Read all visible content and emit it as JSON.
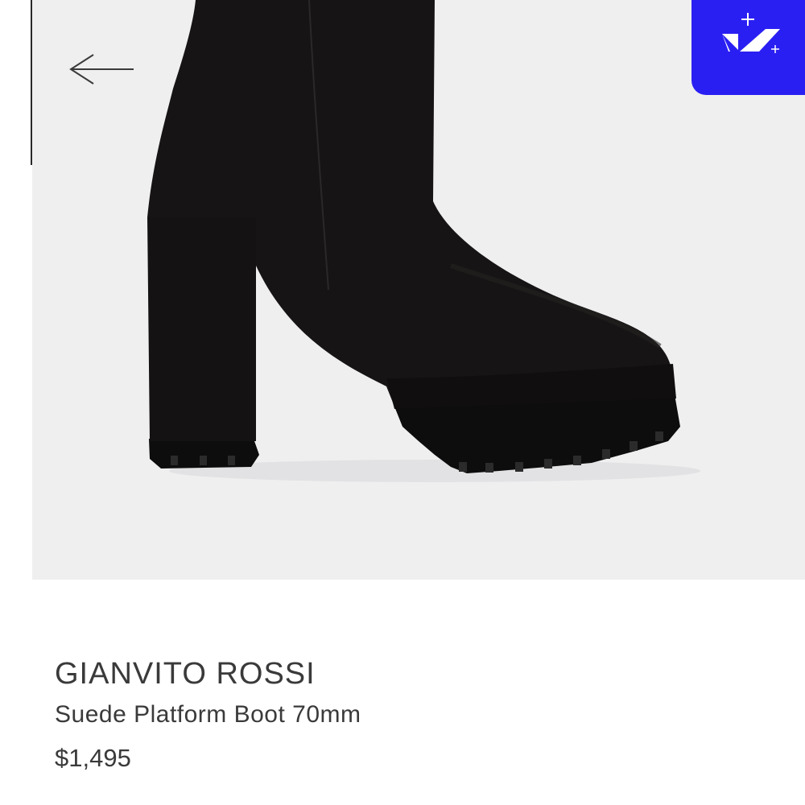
{
  "product": {
    "brand": "GIANVITO ROSSI",
    "name": "Suede Platform Boot 70mm",
    "price": "$1,495",
    "image_description": "black suede platform ankle boot with block heel and lug sole"
  },
  "nav": {
    "back_icon": "arrow-left-icon"
  },
  "badge": {
    "icon": "checkmark-sparkle-icon",
    "color": "#2a1ff2"
  },
  "colors": {
    "image_background": "#efeff0",
    "text": "#3a3a3a"
  }
}
